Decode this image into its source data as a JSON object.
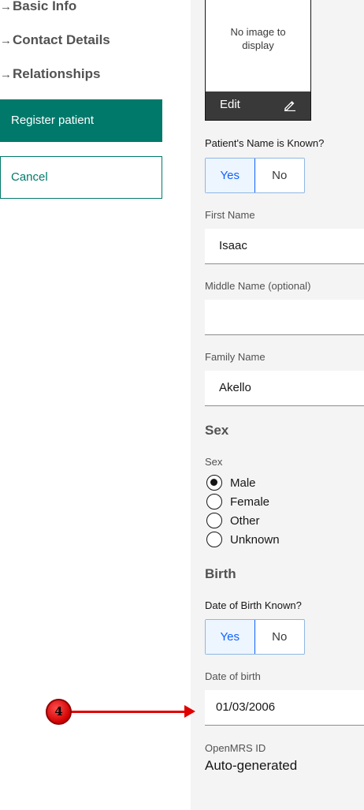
{
  "nav": {
    "items": [
      {
        "arrow": "→",
        "label": "Basic Info"
      },
      {
        "arrow": "→",
        "label": "Contact Details"
      },
      {
        "arrow": "→",
        "label": "Relationships"
      }
    ],
    "register_label": "Register patient",
    "cancel_label": "Cancel"
  },
  "photo": {
    "placeholder": "No image to display",
    "edit_label": "Edit",
    "edit_icon": "pencil-icon"
  },
  "name_known": {
    "label": "Patient's Name is Known?",
    "options": [
      "Yes",
      "No"
    ],
    "selected": "Yes"
  },
  "first_name": {
    "label": "First Name",
    "value": "Isaac"
  },
  "middle_name": {
    "label": "Middle Name (optional)",
    "value": ""
  },
  "family_name": {
    "label": "Family Name",
    "value": "Akello"
  },
  "sex": {
    "section_title": "Sex",
    "label": "Sex",
    "options": [
      "Male",
      "Female",
      "Other",
      "Unknown"
    ],
    "selected": "Male"
  },
  "birth": {
    "section_title": "Birth",
    "dob_known_label": "Date of Birth Known?",
    "options": [
      "Yes",
      "No"
    ],
    "selected": "Yes",
    "dob_label": "Date of birth",
    "dob_value": "01/03/2006"
  },
  "openmrs_id": {
    "label": "OpenMRS ID",
    "value": "Auto-generated"
  },
  "annotation": {
    "number": "4"
  },
  "colors": {
    "primary": "#00796b",
    "selected_blue": "#0f62fe",
    "selected_bg": "#edf5ff",
    "annotation_red": "#e00000",
    "panel_bg": "#f4f4f4"
  }
}
